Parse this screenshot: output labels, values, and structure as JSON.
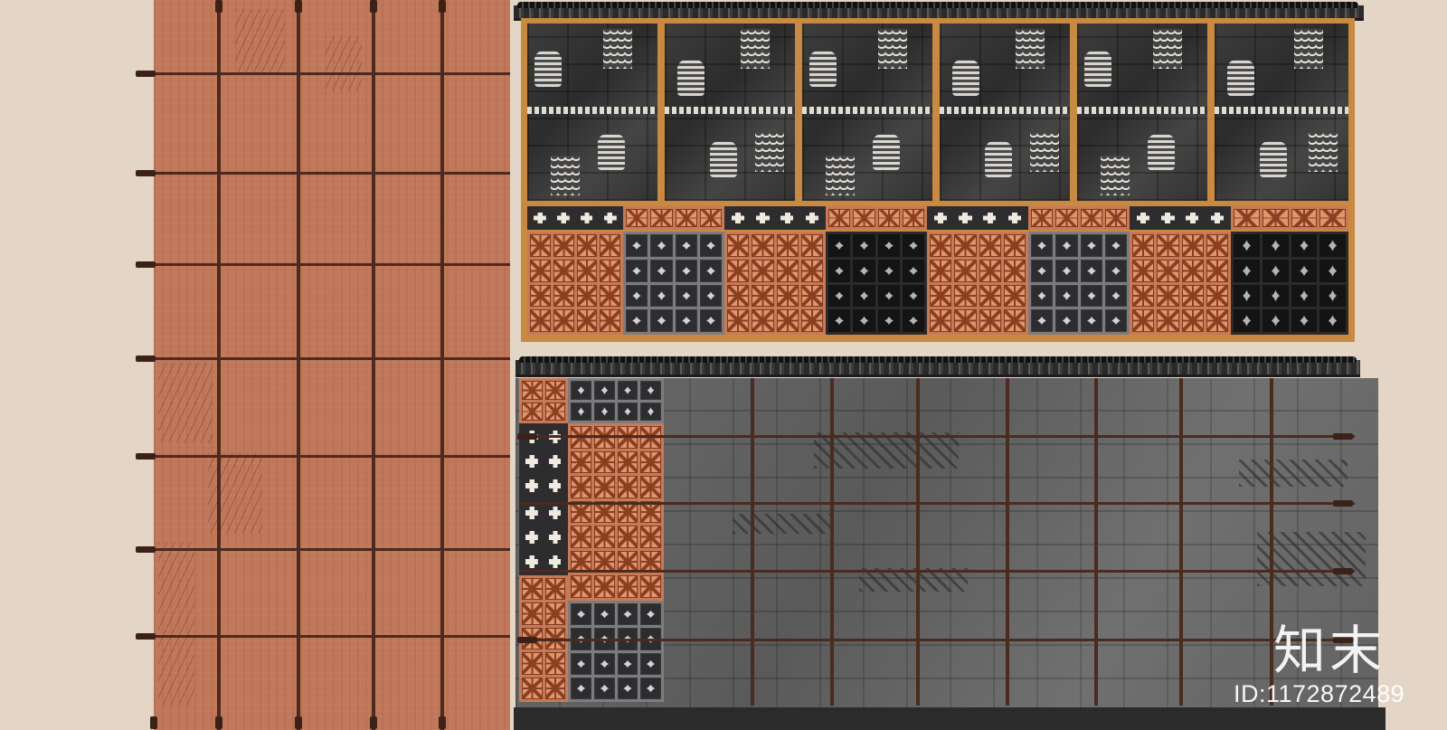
{
  "watermark": {
    "logo_text": "知末",
    "id_text": "ID:1172872489"
  },
  "colors": {
    "background": "#e4d6c7",
    "terracotta": "#c0775a",
    "frame_wood": "#c9893e",
    "grey_stone": "#666666",
    "roof_tile": "#333333"
  }
}
